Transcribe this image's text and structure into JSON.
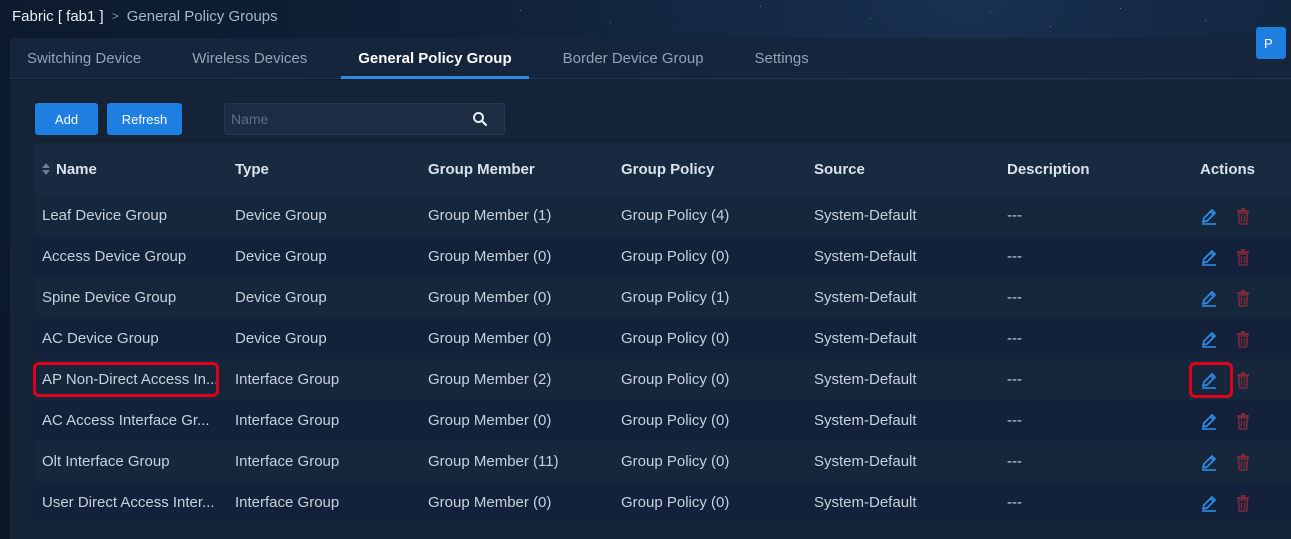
{
  "breadcrumb": {
    "fabric": "Fabric [ fab1 ]",
    "separator": ">",
    "current": "General Policy Groups"
  },
  "tabs": [
    {
      "label": "Switching Device",
      "active": false
    },
    {
      "label": "Wireless Devices",
      "active": false
    },
    {
      "label": "General Policy Group",
      "active": true
    },
    {
      "label": "Border Device Group",
      "active": false
    },
    {
      "label": "Settings",
      "active": false
    }
  ],
  "toolbar": {
    "add_label": "Add",
    "refresh_label": "Refresh",
    "partial_button_label": "P",
    "search_placeholder": "Name",
    "search_icon": "search-icon"
  },
  "table": {
    "columns": [
      "Name",
      "Type",
      "Group Member",
      "Group Policy",
      "Source",
      "Description",
      "Actions"
    ],
    "rows": [
      {
        "name": "Leaf Device Group",
        "type": "Device Group",
        "member": "Group Member (1)",
        "policy": "Group Policy (4)",
        "source": "System-Default",
        "description": "---"
      },
      {
        "name": "Access Device Group",
        "type": "Device Group",
        "member": "Group Member (0)",
        "policy": "Group Policy (0)",
        "source": "System-Default",
        "description": "---"
      },
      {
        "name": "Spine Device Group",
        "type": "Device Group",
        "member": "Group Member (0)",
        "policy": "Group Policy (1)",
        "source": "System-Default",
        "description": "---"
      },
      {
        "name": "AC Device Group",
        "type": "Device Group",
        "member": "Group Member (0)",
        "policy": "Group Policy (0)",
        "source": "System-Default",
        "description": "---"
      },
      {
        "name": "AP Non-Direct Access In...",
        "type": "Interface Group",
        "member": "Group Member (2)",
        "policy": "Group Policy (0)",
        "source": "System-Default",
        "description": "---"
      },
      {
        "name": "AC Access Interface Gr...",
        "type": "Interface Group",
        "member": "Group Member (0)",
        "policy": "Group Policy (0)",
        "source": "System-Default",
        "description": "---"
      },
      {
        "name": "Olt Interface Group",
        "type": "Interface Group",
        "member": "Group Member (11)",
        "policy": "Group Policy (0)",
        "source": "System-Default",
        "description": "---"
      },
      {
        "name": "User Direct Access Inter...",
        "type": "Interface Group",
        "member": "Group Member (0)",
        "policy": "Group Policy (0)",
        "source": "System-Default",
        "description": "---"
      }
    ]
  },
  "colors": {
    "accent": "#1f7fe0",
    "edit_icon": "#2b8ce6",
    "delete_icon": "#7a2a3a",
    "highlight": "#e0001b"
  },
  "icons": {
    "edit": "pencil-icon",
    "delete": "trash-icon",
    "sort": "sort-icon"
  }
}
